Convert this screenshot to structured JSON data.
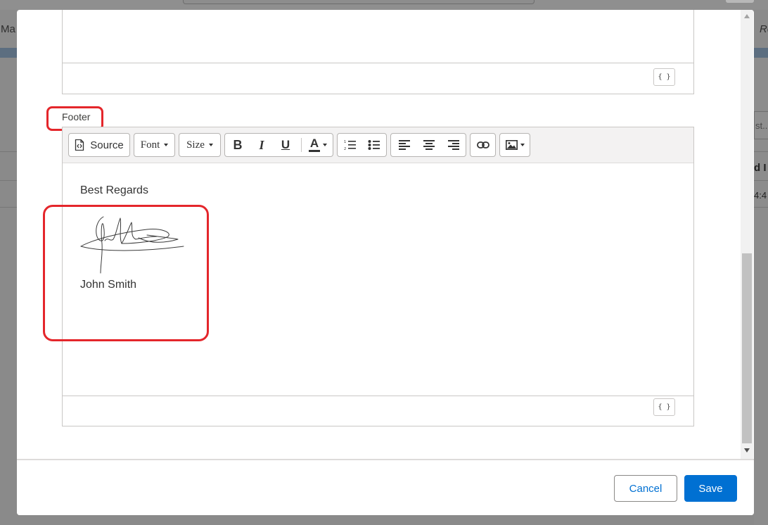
{
  "background": {
    "nav_left_text": "Ma",
    "nav_right_text": "Re",
    "search_placeholder": "st...",
    "right_heading": "d I",
    "right_time": "4:4"
  },
  "prev_editor": {
    "merge_field_label": "{ }"
  },
  "footer_section": {
    "label": "Footer",
    "toolbar": {
      "source_label": "Source",
      "font_label": "Font",
      "size_label": "Size",
      "bold_label": "B",
      "italic_label": "I",
      "underline_label": "U",
      "text_color_label": "A"
    },
    "content": {
      "greeting": "Best Regards",
      "name": "John Smith"
    },
    "merge_field_label": "{ }"
  },
  "dialog": {
    "cancel_label": "Cancel",
    "save_label": "Save"
  },
  "colors": {
    "brand_blue": "#0070d2",
    "highlight_red": "#e4262b"
  }
}
